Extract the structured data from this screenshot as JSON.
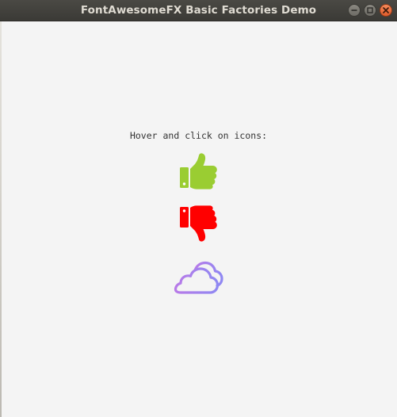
{
  "window": {
    "title": "FontAwesomeFX Basic Factories Demo",
    "controls": {
      "minimize": "minimize-icon",
      "maximize": "maximize-icon",
      "close": "close-icon"
    }
  },
  "main": {
    "prompt": "Hover and click on icons:",
    "icons": [
      {
        "name": "thumbs-up-icon",
        "color": "#9acd32"
      },
      {
        "name": "thumbs-down-icon",
        "color": "#ff0000"
      },
      {
        "name": "cloud-icon",
        "color": "#9a7cf0"
      }
    ]
  },
  "colors": {
    "background": "#f4f4f4",
    "titlebar": "#3c3b37",
    "close_button": "#e95420"
  }
}
